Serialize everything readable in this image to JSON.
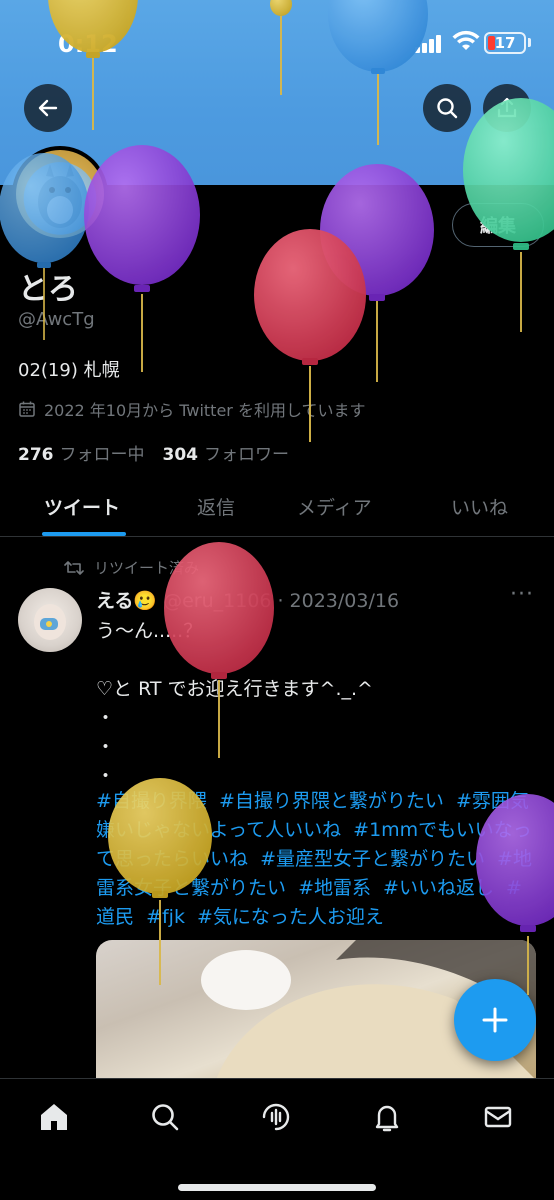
{
  "status_bar": {
    "time": "0:12",
    "battery": "17"
  },
  "profile": {
    "name": "とろ",
    "handle": "@AwcTg",
    "bio": "02(19) 札幌",
    "joined": "2022 年10月から Twitter を利用しています",
    "following_count": "276",
    "following_label": "フォロー中",
    "followers_count": "304",
    "followers_label": "フォロワー",
    "edit_label": "編集"
  },
  "tabs": [
    {
      "label": "ツイート",
      "active": true
    },
    {
      "label": "返信",
      "active": false
    },
    {
      "label": "メディア",
      "active": false
    },
    {
      "label": "いいね",
      "active": false
    }
  ],
  "tweet": {
    "retweet_label": "リツイート済み",
    "author_name": "える🥲",
    "author_handle": "@eru_1106",
    "date": "2023/03/16",
    "body": "う〜ん.....？\n\n♡と RT でお迎え行きます^._.^\n・\n・\n・",
    "hashtags": [
      "#自撮り界隈",
      "#自撮り界隈と繋がりたい",
      "#雰囲気嫌いじゃないよって人いいね",
      "#1mmでもいいなって思ったらいいね",
      "#量産型女子と繋がりたい",
      "#地雷系女子と繋がりたい",
      "#地雷系",
      "#いいね返し",
      "#道民",
      "#fjk",
      "#気になった人お迎え"
    ]
  },
  "icons": {
    "back": "arrow-left-icon",
    "search": "search-icon",
    "share": "share-icon",
    "calendar": "calendar-icon",
    "retweet": "retweet-icon",
    "more": "more-icon",
    "compose": "plus-icon",
    "nav": [
      "home-icon",
      "search-icon",
      "spaces-icon",
      "bell-icon",
      "mail-icon"
    ]
  },
  "colors": {
    "accent": "#1d9bf0",
    "banner": "#4d9be0",
    "background": "#000000"
  }
}
